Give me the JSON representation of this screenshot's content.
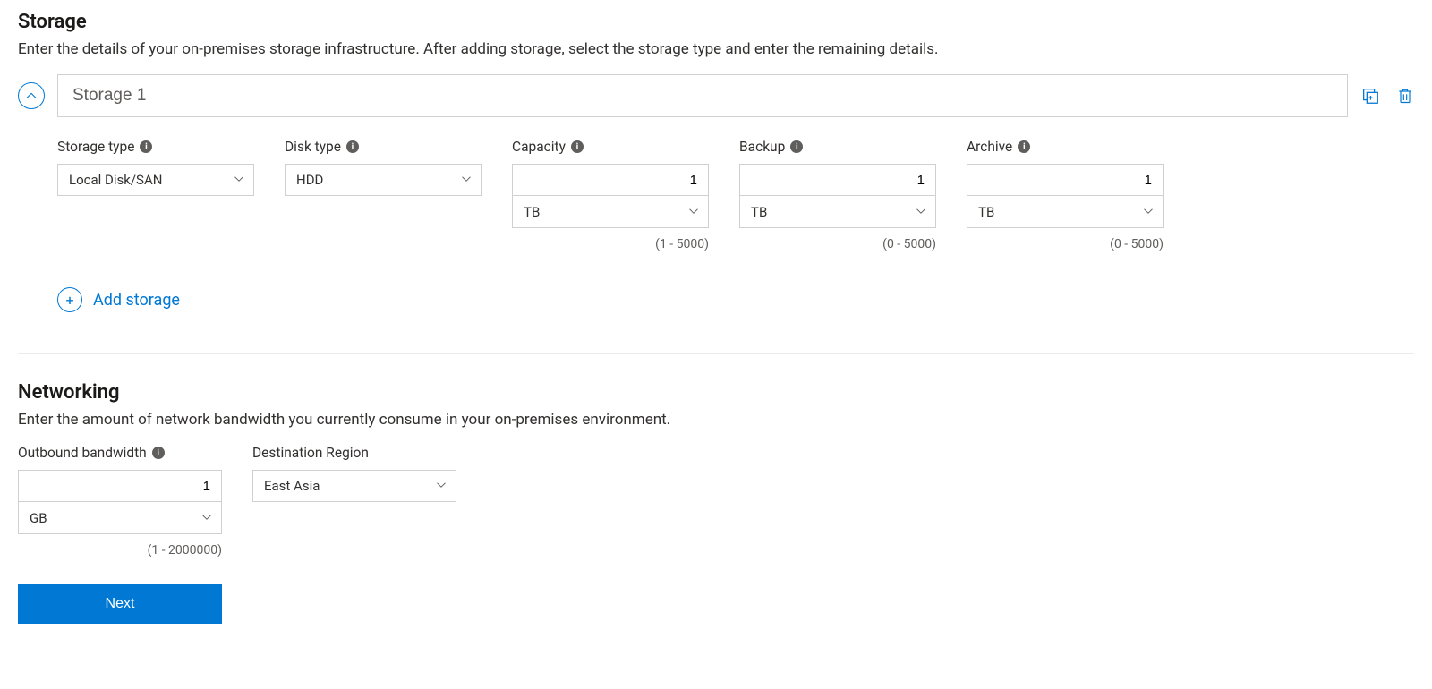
{
  "storage": {
    "heading": "Storage",
    "description": "Enter the details of your on-premises storage infrastructure. After adding storage, select the storage type and enter the remaining details.",
    "item_name": "Storage 1",
    "fields": {
      "storage_type": {
        "label": "Storage type",
        "value": "Local Disk/SAN"
      },
      "disk_type": {
        "label": "Disk type",
        "value": "HDD"
      },
      "capacity": {
        "label": "Capacity",
        "value": "1",
        "unit": "TB",
        "hint": "(1 - 5000)"
      },
      "backup": {
        "label": "Backup",
        "value": "1",
        "unit": "TB",
        "hint": "(0 - 5000)"
      },
      "archive": {
        "label": "Archive",
        "value": "1",
        "unit": "TB",
        "hint": "(0 - 5000)"
      }
    },
    "add_label": "Add storage"
  },
  "networking": {
    "heading": "Networking",
    "description": "Enter the amount of network bandwidth you currently consume in your on-premises environment.",
    "outbound": {
      "label": "Outbound bandwidth",
      "value": "1",
      "unit": "GB",
      "hint": "(1 - 2000000)"
    },
    "region": {
      "label": "Destination Region",
      "value": "East Asia"
    }
  },
  "buttons": {
    "next": "Next"
  }
}
